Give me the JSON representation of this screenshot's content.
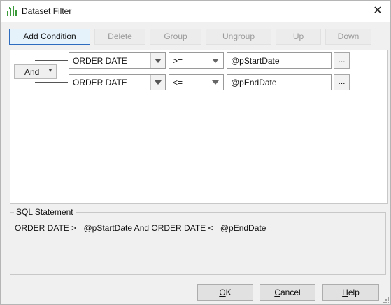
{
  "window": {
    "title": "Dataset Filter",
    "close_glyph": "✕",
    "icon": "bar-chart-icon"
  },
  "toolbar": {
    "buttons": [
      {
        "label": "Add Condition",
        "enabled": true
      },
      {
        "label": "Delete",
        "enabled": false
      },
      {
        "label": "Group",
        "enabled": false
      },
      {
        "label": "Ungroup",
        "enabled": false
      },
      {
        "label": "Up",
        "enabled": false
      },
      {
        "label": "Down",
        "enabled": false
      }
    ]
  },
  "group": {
    "operator": "And"
  },
  "conditions": [
    {
      "field": "ORDER DATE",
      "operator": ">=",
      "value": "@pStartDate",
      "browse_label": "..."
    },
    {
      "field": "ORDER DATE",
      "operator": "<=",
      "value": "@pEndDate",
      "browse_label": "..."
    }
  ],
  "sql": {
    "legend": "SQL Statement",
    "statement": "ORDER DATE >= @pStartDate And ORDER DATE <= @pEndDate"
  },
  "footer": {
    "ok": {
      "mnemonic": "O",
      "rest": "K"
    },
    "cancel": {
      "mnemonic": "C",
      "rest": "ancel"
    },
    "help": {
      "mnemonic": "H",
      "rest": "elp"
    }
  },
  "colors": {
    "accent": "#2e6cc0",
    "dialog_bg": "#f0f0f0",
    "icon_green": "#3a9a3a"
  }
}
